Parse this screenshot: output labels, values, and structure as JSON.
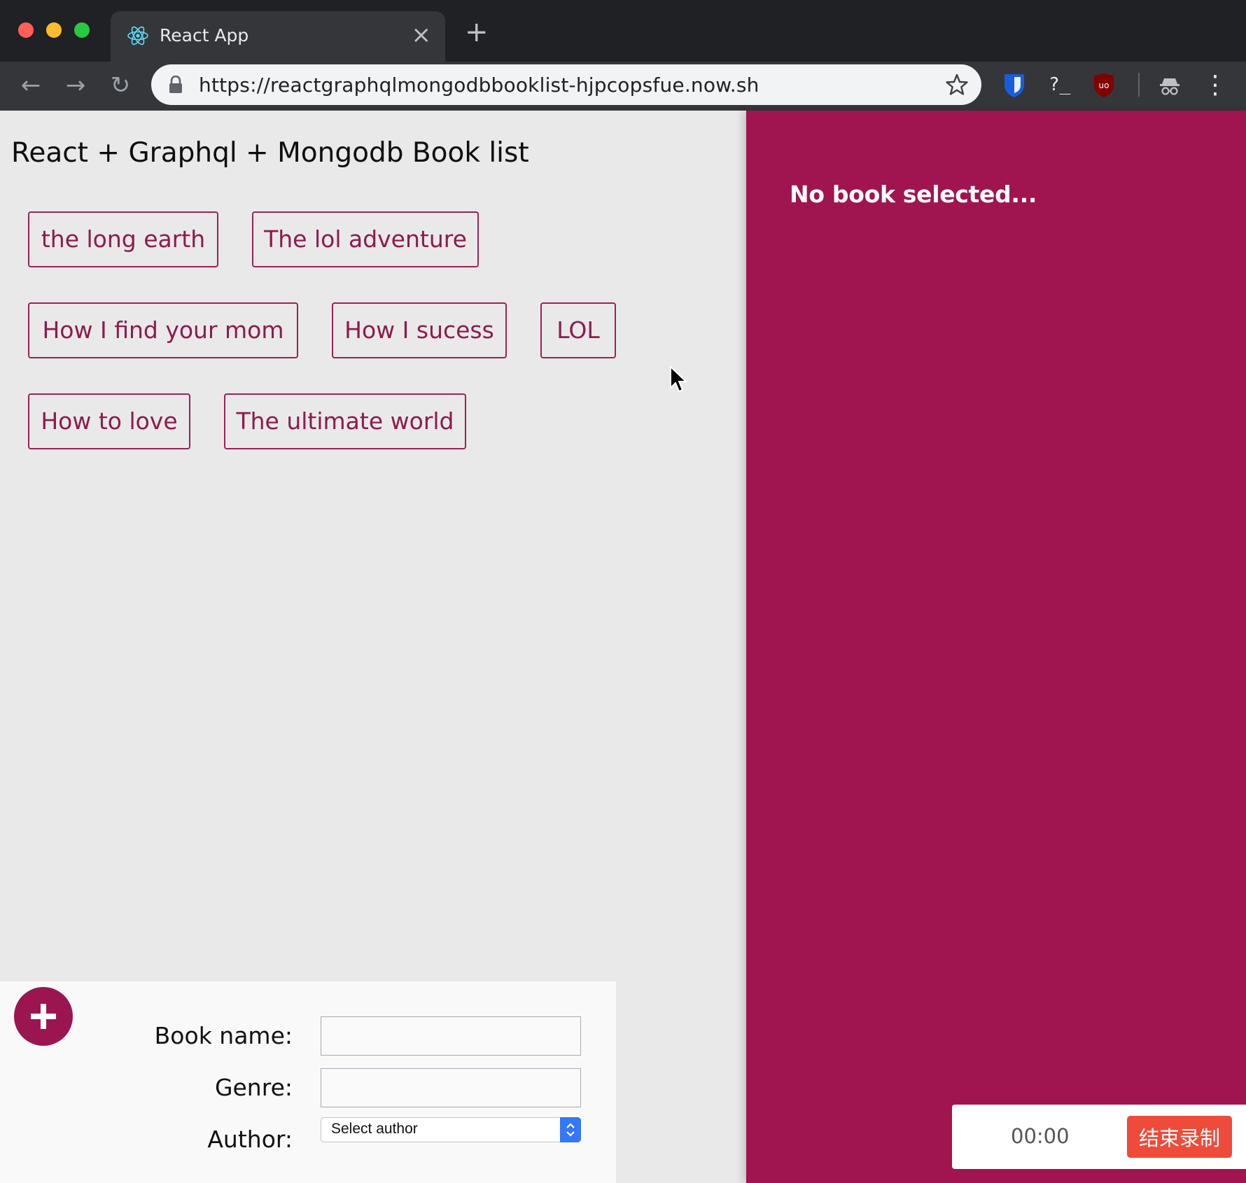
{
  "browser": {
    "tab_title": "React App",
    "tab_close": "×",
    "new_tab": "+",
    "url": "https://reactgraphqlmongodbbooklist-hjpcopsfue.now.sh",
    "back": "←",
    "forward": "→",
    "reload": "↻",
    "extension_terminal": "?_",
    "menu": "⋮"
  },
  "page": {
    "title": "React + Graphql + Mongodb Book list"
  },
  "books": [
    {
      "title": "the long earth"
    },
    {
      "title": "The lol adventure"
    },
    {
      "title": "How I find your mom"
    },
    {
      "title": "How I sucess"
    },
    {
      "title": "LOL"
    },
    {
      "title": "How to love"
    },
    {
      "title": "The ultimate world"
    }
  ],
  "form": {
    "book_name_label": "Book name:",
    "book_name_value": "",
    "genre_label": "Genre:",
    "genre_value": "",
    "author_label": "Author:",
    "author_selected": "Select author",
    "add_button_icon": "plus-icon"
  },
  "details": {
    "empty_text": "No book selected..."
  },
  "recorder": {
    "time": "00:00",
    "stop_label": "结束录制"
  },
  "colors": {
    "accent": "#a0144f",
    "book_border": "#9b2157",
    "book_text": "#8e1a4d",
    "stop_button": "#ef4b3a"
  }
}
